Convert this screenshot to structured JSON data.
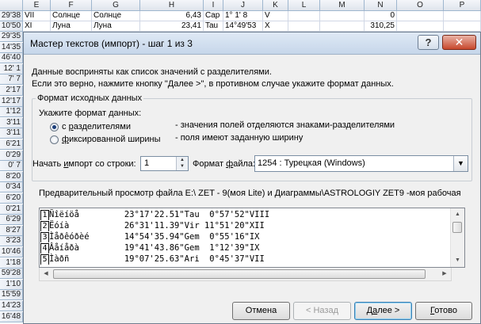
{
  "sheet": {
    "columns": [
      "E",
      "F",
      "G",
      "H",
      "I",
      "J",
      "K",
      "L",
      "M",
      "N",
      "O",
      "P"
    ],
    "rows": [
      {
        "rowhdr": "29'38",
        "e": "VII",
        "f": "Солнце",
        "g": "Солнце",
        "h": "6,43",
        "i": "Cap",
        "j": "1° 1' 8",
        "k": "V",
        "n": "0"
      },
      {
        "rowhdr": "10'50",
        "e": "XI",
        "f": "Луна",
        "g": "Луна",
        "h": "23,41",
        "i": "Tau",
        "j": "14°49'53",
        "k": "X",
        "n": "310,25"
      }
    ],
    "row_headers": [
      "29'35",
      "14'35",
      "46'40",
      "12' 1",
      "7' 7",
      "2'17",
      "12'17",
      "1'12",
      "3'11",
      "3'11",
      "6'21",
      "0'29",
      "0' 7",
      "8'20",
      "0'34",
      "6'20",
      "0'21",
      "6'29",
      "8'27",
      "3'23",
      "10'46",
      "1'18",
      "59'28",
      "1'10",
      "15'59",
      "14'23",
      "16'48"
    ]
  },
  "dialog": {
    "title": "Мастер текстов (импорт) - шаг 1 из 3",
    "help_label": "?",
    "close_label": "✕",
    "intro_line1": "Данные восприняты как список значений с разделителями.",
    "intro_line2": "Если это верно, нажмите кнопку \"Далее >\", в противном случае укажите формат данных.",
    "format_group": {
      "title": "Формат исходных данных",
      "prompt": "Укажите формат данных:",
      "options": [
        {
          "label_pre": "с ",
          "label_u": "р",
          "label_post": "азделителями",
          "desc": "- значения полей отделяются знаками-разделителями",
          "selected": true
        },
        {
          "label_pre": "",
          "label_u": "ф",
          "label_post": "иксированной ширины",
          "desc": "- поля имеют заданную ширину",
          "selected": false
        }
      ]
    },
    "start_row": {
      "label_pre": "Начать ",
      "label_u": "и",
      "label_post": "мпорт со строки:",
      "value": "1"
    },
    "file_format": {
      "label_pre": "Формат ",
      "label_u": "ф",
      "label_post": "айла:",
      "value": "1254 : Турецкая (Windows)"
    },
    "preview": {
      "label": "Предварительный просмотр файла E:\\ ZET - 9(моя Lite) и Диаграммы\\ASTROLOGIY  ZET9 -моя рабочая",
      "lines": [
        {
          "n": "1",
          "text": "Ñîëíöå         23°17'22.51\"Tau  0°57'52\"VIII"
        },
        {
          "n": "2",
          "text": "Ëóíà           26°31'11.39\"Vir 11°51'20\"XII"
        },
        {
          "n": "3",
          "text": "Ìåðêóðèé       14°54'35.94\"Gem  0°55'16\"IX"
        },
        {
          "n": "4",
          "text": "Âåíåðà         19°41'43.86\"Gem  1°12'39\"IX"
        },
        {
          "n": "5",
          "text": "Ìàðñ           19°07'25.63\"Ari  0°45'37\"VII"
        }
      ]
    },
    "buttons": {
      "cancel": "Отмена",
      "back": "< Назад",
      "next_pre": "Д",
      "next_u": "а",
      "next_post": "лее >",
      "finish_pre": "",
      "finish_u": "Г",
      "finish_post": "отово"
    }
  },
  "colors": {
    "accent": "#3c7fb1",
    "titlebar": "#c6d6ea",
    "close": "#c7472c"
  }
}
